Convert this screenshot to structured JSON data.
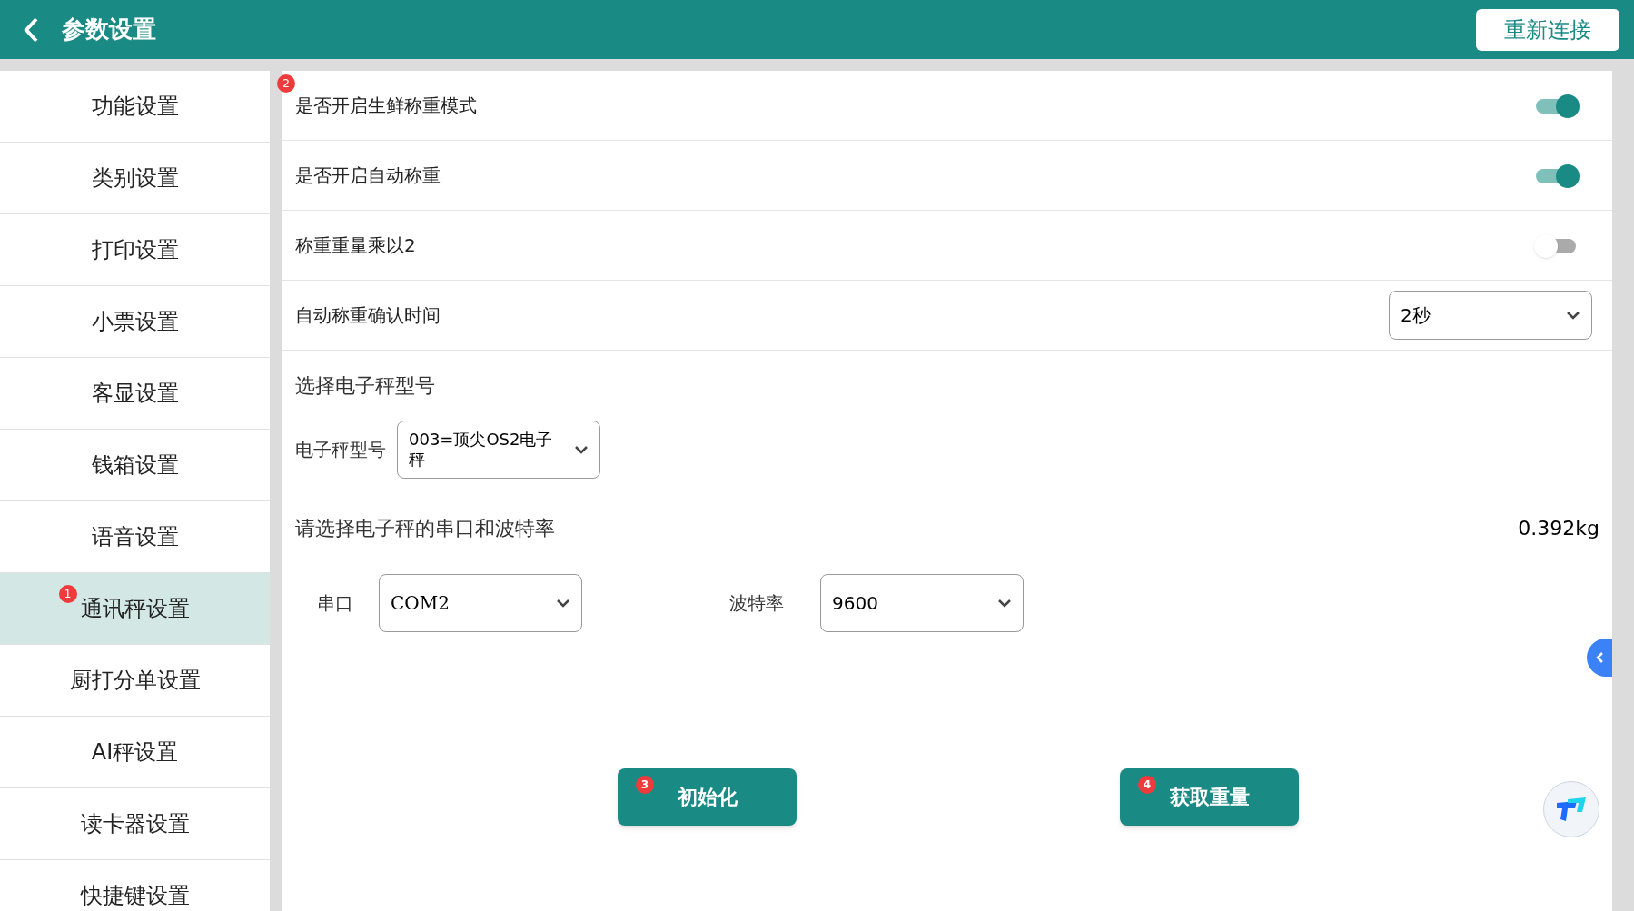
{
  "header": {
    "title": "参数设置",
    "reconnect_button": "重新连接"
  },
  "sidebar": {
    "items": [
      {
        "label": "功能设置",
        "selected": false
      },
      {
        "label": "类别设置",
        "selected": false
      },
      {
        "label": "打印设置",
        "selected": false
      },
      {
        "label": "小票设置",
        "selected": false
      },
      {
        "label": "客显设置",
        "selected": false
      },
      {
        "label": "钱箱设置",
        "selected": false
      },
      {
        "label": "语音设置",
        "selected": false
      },
      {
        "label": "通讯秤设置",
        "selected": true,
        "badge": "1"
      },
      {
        "label": "厨打分单设置",
        "selected": false
      },
      {
        "label": "AI秤设置",
        "selected": false
      },
      {
        "label": "读卡器设置",
        "selected": false
      },
      {
        "label": "快捷键设置",
        "selected": false
      }
    ]
  },
  "settings": [
    {
      "kind": "toggle",
      "label": "是否开启生鲜称重模式",
      "on": true,
      "badge": "2"
    },
    {
      "kind": "toggle",
      "label": "是否开启自动称重",
      "on": true
    },
    {
      "kind": "toggle",
      "label": "称重重量乘以2",
      "on": false
    },
    {
      "kind": "select",
      "label": "自动称重确认时间",
      "value": "2秒"
    }
  ],
  "scale_model": {
    "heading": "选择电子秤型号",
    "label": "电子秤型号",
    "value": "003=顶尖OS2电子秤"
  },
  "serial": {
    "heading": "请选择电子秤的串口和波特率",
    "weight": "0.392kg",
    "port_label": "串口",
    "port_value": "COM2",
    "baud_label": "波特率",
    "baud_value": "9600"
  },
  "buttons": [
    {
      "label": "初始化",
      "badge": "3"
    },
    {
      "label": "获取重量",
      "badge": "4"
    }
  ]
}
